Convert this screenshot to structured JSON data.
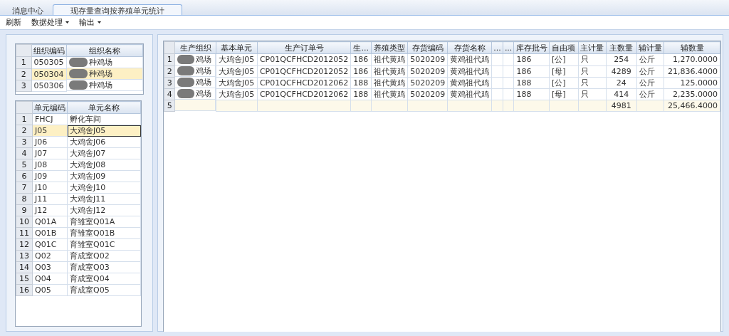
{
  "tabs": [
    {
      "label": "消息中心",
      "selected": false
    },
    {
      "label": "现存量查询按养殖单元统计",
      "selected": true
    }
  ],
  "toolbar": [
    {
      "label": "刷新",
      "dropdown": false
    },
    {
      "label": "数据处理",
      "dropdown": true
    },
    {
      "label": "输出",
      "dropdown": true
    }
  ],
  "org_table": {
    "columns": [
      "组织编码",
      "组织名称"
    ],
    "rows": [
      {
        "num": "1",
        "cells": [
          "050305",
          "种鸡场"
        ],
        "redacted": true,
        "selected": false
      },
      {
        "num": "2",
        "cells": [
          "050304",
          "种鸡场"
        ],
        "redacted": true,
        "selected": true
      },
      {
        "num": "3",
        "cells": [
          "050306",
          "种鸡场"
        ],
        "redacted": true,
        "selected": false
      }
    ]
  },
  "unit_table": {
    "columns": [
      "单元编码",
      "单元名称"
    ],
    "rows": [
      {
        "num": "1",
        "cells": [
          "FHCJ",
          "孵化车间"
        ],
        "selected": false
      },
      {
        "num": "2",
        "cells": [
          "J05",
          "大鸡舍J05"
        ],
        "selected": true
      },
      {
        "num": "3",
        "cells": [
          "J06",
          "大鸡舍J06"
        ],
        "selected": false
      },
      {
        "num": "4",
        "cells": [
          "J07",
          "大鸡舍J07"
        ],
        "selected": false
      },
      {
        "num": "5",
        "cells": [
          "J08",
          "大鸡舍J08"
        ],
        "selected": false
      },
      {
        "num": "6",
        "cells": [
          "J09",
          "大鸡舍J09"
        ],
        "selected": false
      },
      {
        "num": "7",
        "cells": [
          "J10",
          "大鸡舍J10"
        ],
        "selected": false
      },
      {
        "num": "8",
        "cells": [
          "J11",
          "大鸡舍J11"
        ],
        "selected": false
      },
      {
        "num": "9",
        "cells": [
          "J12",
          "大鸡舍J12"
        ],
        "selected": false
      },
      {
        "num": "10",
        "cells": [
          "Q01A",
          "育雏室Q01A"
        ],
        "selected": false
      },
      {
        "num": "11",
        "cells": [
          "Q01B",
          "育雏室Q01B"
        ],
        "selected": false
      },
      {
        "num": "12",
        "cells": [
          "Q01C",
          "育雏室Q01C"
        ],
        "selected": false
      },
      {
        "num": "13",
        "cells": [
          "Q02",
          "育成室Q02"
        ],
        "selected": false
      },
      {
        "num": "14",
        "cells": [
          "Q03",
          "育成室Q03"
        ],
        "selected": false
      },
      {
        "num": "15",
        "cells": [
          "Q04",
          "育成室Q04"
        ],
        "selected": false
      },
      {
        "num": "16",
        "cells": [
          "Q05",
          "育成室Q05"
        ],
        "selected": false
      }
    ]
  },
  "stock_table": {
    "columns": [
      "生产组织",
      "基本单元",
      "生产订单号",
      "生...",
      "养殖类型",
      "存货编码",
      "存货名称",
      "...",
      "...",
      "库存批号",
      "自由项",
      "主计量",
      "主数量",
      "辅计量",
      "辅数量"
    ],
    "rows": [
      {
        "num": "1",
        "kind": "data",
        "redacted": true,
        "cells": [
          "鸡场",
          "大鸡舍J05",
          "CP01QCFHCD2012052",
          "186",
          "祖代黄鸡",
          "5020209",
          "黄鸡祖代鸡",
          "",
          "",
          "186",
          "[公]",
          "只",
          "254",
          "公斤",
          "1,270.0000"
        ]
      },
      {
        "num": "2",
        "kind": "data",
        "redacted": true,
        "cells": [
          "鸡场",
          "大鸡舍J05",
          "CP01QCFHCD2012052",
          "186",
          "祖代黄鸡",
          "5020209",
          "黄鸡祖代鸡",
          "",
          "",
          "186",
          "[母]",
          "只",
          "4289",
          "公斤",
          "21,836.4000"
        ]
      },
      {
        "num": "3",
        "kind": "data",
        "redacted": true,
        "cells": [
          "鸡场",
          "大鸡舍J05",
          "CP01QCFHCD2012062",
          "188",
          "祖代黄鸡",
          "5020209",
          "黄鸡祖代鸡",
          "",
          "",
          "188",
          "[公]",
          "只",
          "24",
          "公斤",
          "125.0000"
        ]
      },
      {
        "num": "4",
        "kind": "data",
        "redacted": true,
        "cells": [
          "鸡场",
          "大鸡舍J05",
          "CP01QCFHCD2012062",
          "188",
          "祖代黄鸡",
          "5020209",
          "黄鸡祖代鸡",
          "",
          "",
          "188",
          "[母]",
          "只",
          "414",
          "公斤",
          "2,235.0000"
        ]
      },
      {
        "num": "5",
        "kind": "total",
        "redacted": false,
        "cells": [
          "",
          "",
          "",
          "",
          "",
          "",
          "",
          "",
          "",
          "",
          "",
          "",
          "4981",
          "",
          "25,466.4000"
        ]
      }
    ]
  }
}
